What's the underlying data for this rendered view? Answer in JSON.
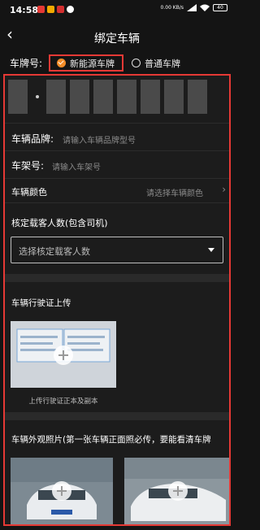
{
  "status": {
    "time": "14:58",
    "net_speed": "0.00 KB/s",
    "battery": "40"
  },
  "header": {
    "title": "绑定车辆"
  },
  "plate_type": {
    "label": "车牌号:",
    "options": [
      {
        "label": "新能源车牌",
        "selected": true
      },
      {
        "label": "普通车牌",
        "selected": false
      }
    ]
  },
  "plate_boxes": 8,
  "fields": {
    "brand": {
      "label": "车辆品牌:",
      "placeholder": "请输入车辆品牌型号"
    },
    "vin": {
      "label": "车架号:",
      "placeholder": "请输入车架号"
    },
    "color": {
      "label": "车辆颜色",
      "placeholder": "请选择车辆颜色"
    }
  },
  "capacity": {
    "label": "核定载客人数(包含司机)",
    "placeholder": "选择核定载客人数"
  },
  "license": {
    "title": "车辆行驶证上传",
    "caption": "上传行驶证正本及副本"
  },
  "photos": {
    "title": "车辆外观照片(第一张车辆正面照必传，要能看清车牌"
  },
  "colors": {
    "accent": "#f28c28",
    "highlight": "#e53935",
    "background": "#141414"
  }
}
